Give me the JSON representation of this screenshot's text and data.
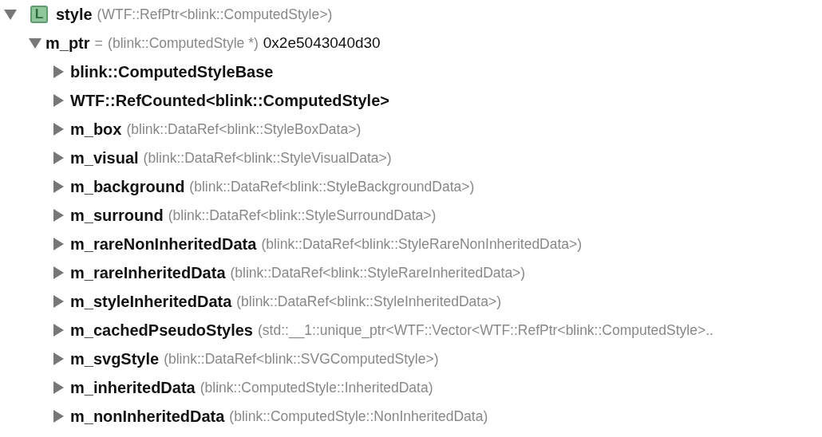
{
  "variables": [
    {
      "name": "style",
      "badge": "L",
      "type": "(WTF::RefPtr<blink::ComputedStyle>)",
      "expanded": true,
      "children": [
        {
          "name": "m_ptr",
          "separator": "=",
          "type": "(blink::ComputedStyle *)",
          "value": "0x2e5043040d30",
          "expanded": true,
          "children": [
            {
              "name": "blink::ComputedStyleBase",
              "expanded": false
            },
            {
              "name": "WTF::RefCounted<blink::ComputedStyle>",
              "expanded": false
            },
            {
              "name": "m_box",
              "type": "(blink::DataRef<blink::StyleBoxData>)",
              "expanded": false
            },
            {
              "name": "m_visual",
              "type": "(blink::DataRef<blink::StyleVisualData>)",
              "expanded": false
            },
            {
              "name": "m_background",
              "type": "(blink::DataRef<blink::StyleBackgroundData>)",
              "expanded": false
            },
            {
              "name": "m_surround",
              "type": "(blink::DataRef<blink::StyleSurroundData>)",
              "expanded": false
            },
            {
              "name": "m_rareNonInheritedData",
              "type": "(blink::DataRef<blink::StyleRareNonInheritedData>)",
              "expanded": false
            },
            {
              "name": "m_rareInheritedData",
              "type": "(blink::DataRef<blink::StyleRareInheritedData>)",
              "expanded": false
            },
            {
              "name": "m_styleInheritedData",
              "type": "(blink::DataRef<blink::StyleInheritedData>)",
              "expanded": false
            },
            {
              "name": "m_cachedPseudoStyles",
              "type": "(std::__1::unique_ptr<WTF::Vector<WTF::RefPtr<blink::ComputedStyle>..",
              "expanded": false
            },
            {
              "name": "m_svgStyle",
              "type": "(blink::DataRef<blink::SVGComputedStyle>)",
              "expanded": false
            },
            {
              "name": "m_inheritedData",
              "type": "(blink::ComputedStyle::InheritedData)",
              "expanded": false
            },
            {
              "name": "m_nonInheritedData",
              "type": "(blink::ComputedStyle::NonInheritedData)",
              "expanded": false
            }
          ]
        }
      ]
    }
  ]
}
